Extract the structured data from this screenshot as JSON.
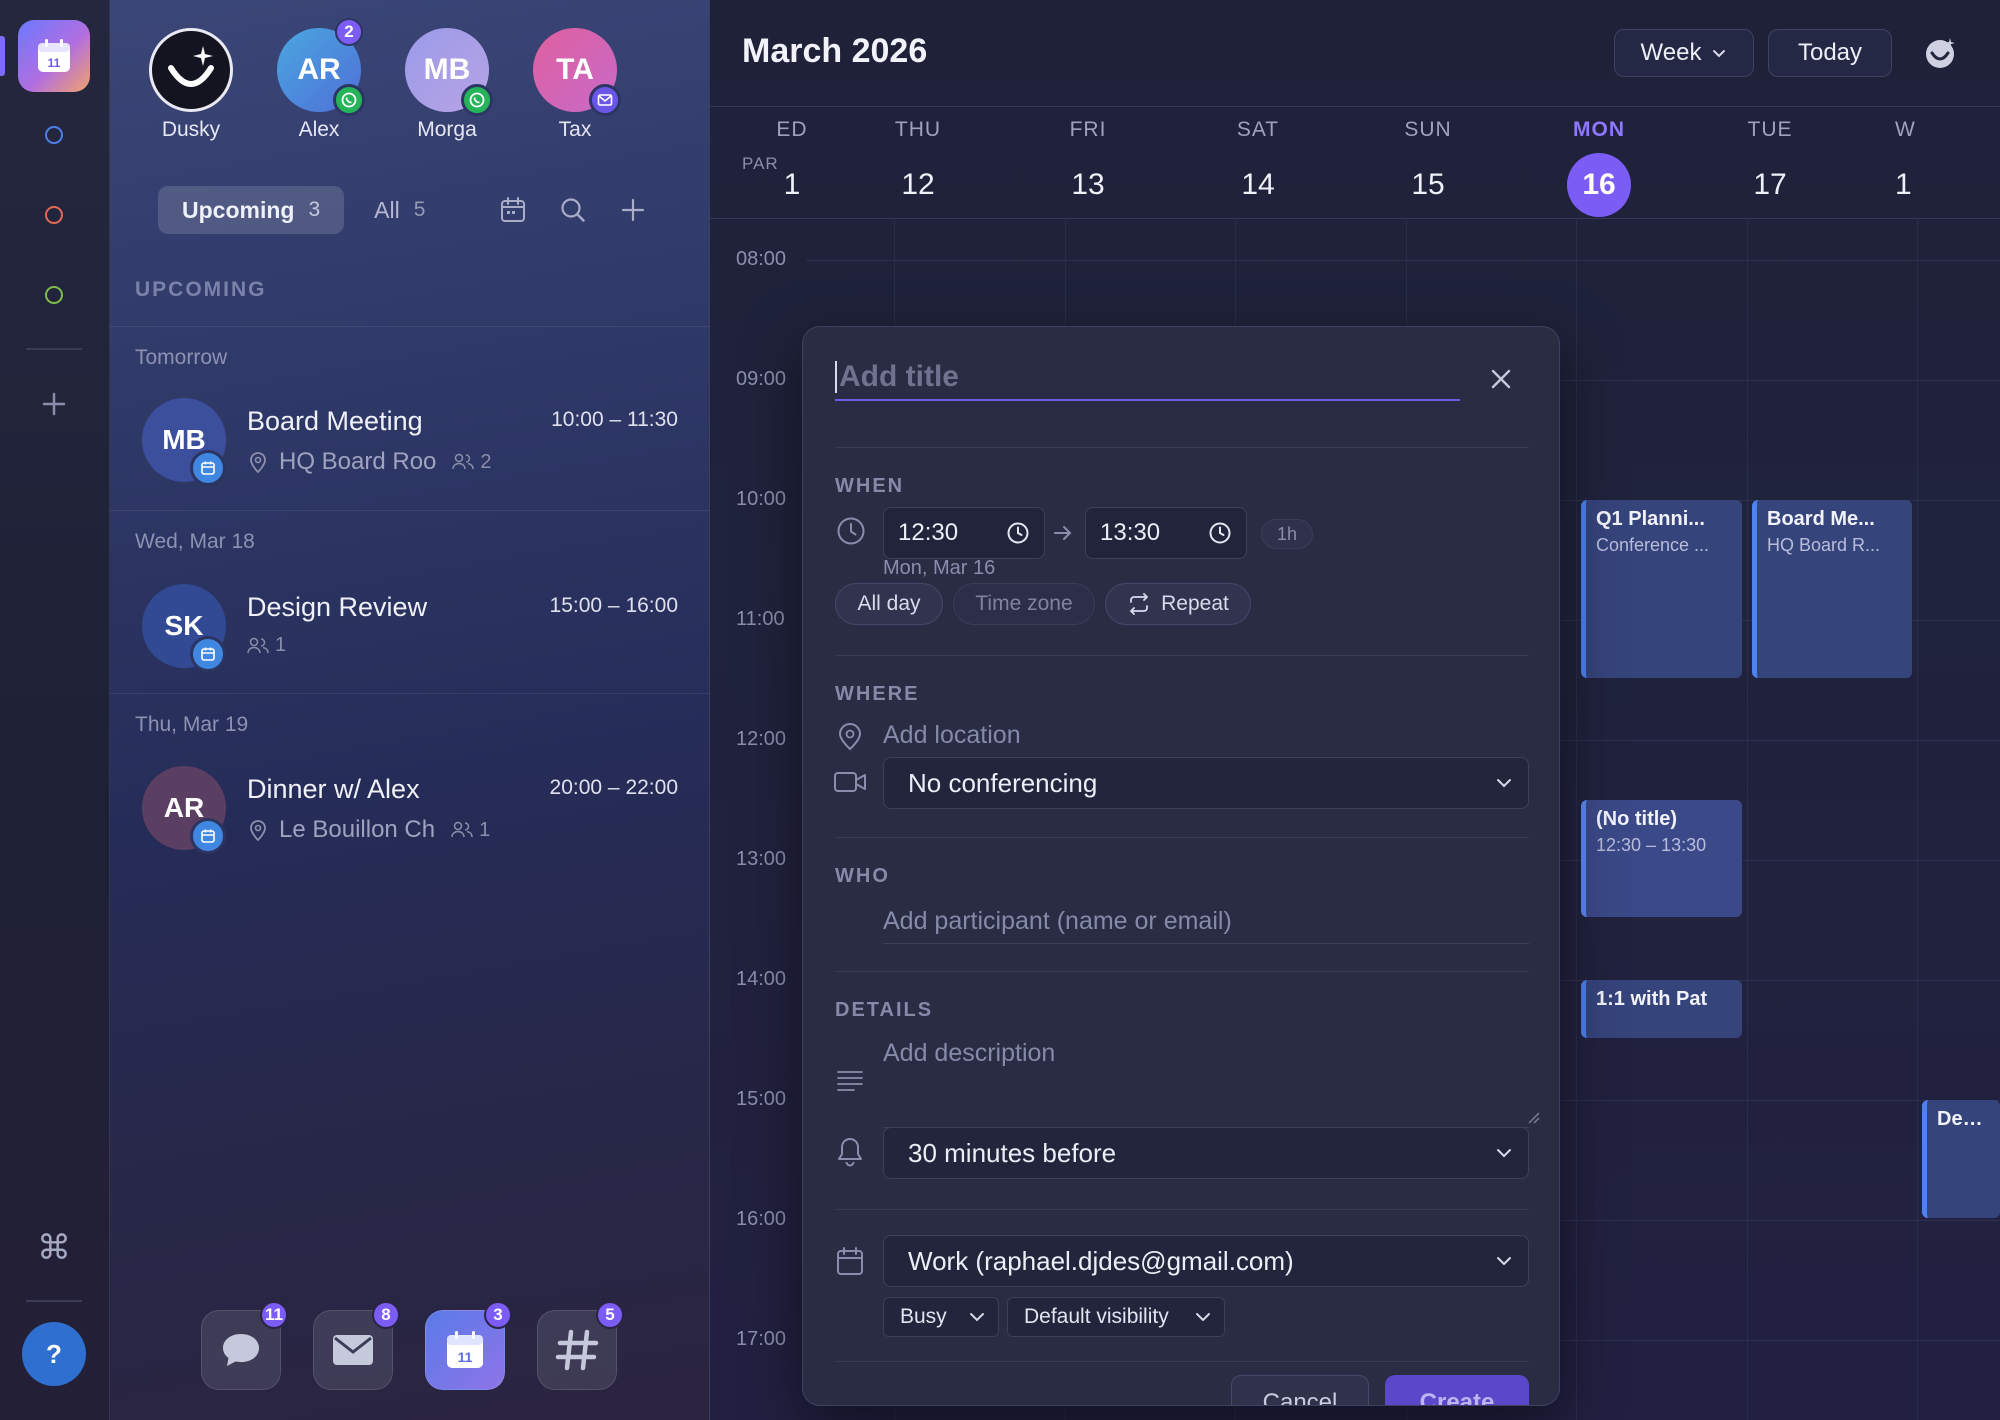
{
  "rail": {
    "app_icon_day": "11",
    "help_label": "?",
    "command_glyph": "⌘",
    "dot_colors": [
      "#4f7fe8",
      "#e06a55",
      "#7dbb4a"
    ]
  },
  "contacts": [
    {
      "initials": "",
      "name": "Dusky",
      "icon": "dusky-logo-icon"
    },
    {
      "initials": "AR",
      "name": "Alex",
      "badge": "2",
      "channel": "whatsapp-icon"
    },
    {
      "initials": "MB",
      "name": "Morga",
      "channel": "whatsapp-icon"
    },
    {
      "initials": "TA",
      "name": "Tax",
      "channel": "mail-icon"
    }
  ],
  "tabs": {
    "upcoming_label": "Upcoming",
    "upcoming_count": "3",
    "all_label": "All",
    "all_count": "5"
  },
  "list": {
    "section_label": "UPCOMING",
    "groups": [
      {
        "day": "Tomorrow",
        "event": {
          "initials": "MB",
          "title": "Board Meeting",
          "time": "10:00 – 11:30",
          "location": "HQ Board Roo",
          "people": "2"
        }
      },
      {
        "day": "Wed, Mar 18",
        "event": {
          "initials": "SK",
          "title": "Design Review",
          "time": "15:00 – 16:00",
          "location": "",
          "people": "1"
        }
      },
      {
        "day": "Thu, Mar 19",
        "event": {
          "initials": "AR",
          "title": "Dinner w/ Alex",
          "time": "20:00 – 22:00",
          "location": "Le Bouillon Ch",
          "people": "1"
        }
      }
    ]
  },
  "dock": [
    {
      "icon": "chat-icon",
      "count": "11"
    },
    {
      "icon": "mail-icon",
      "count": "8"
    },
    {
      "icon": "calendar-icon",
      "count": "3",
      "day": "11"
    },
    {
      "icon": "hashtag-icon",
      "count": "5"
    }
  ],
  "calendar": {
    "title": "March 2026",
    "view_label": "Week",
    "today_label": "Today",
    "timezone_label": "PAR",
    "days": [
      {
        "name": "ED",
        "date": "1"
      },
      {
        "name": "THU",
        "date": "12"
      },
      {
        "name": "FRI",
        "date": "13"
      },
      {
        "name": "SAT",
        "date": "14"
      },
      {
        "name": "SUN",
        "date": "15"
      },
      {
        "name": "MON",
        "date": "16",
        "today": true
      },
      {
        "name": "TUE",
        "date": "17"
      },
      {
        "name": "W",
        "date": "1"
      }
    ],
    "hours": [
      "08:00",
      "09:00",
      "10:00",
      "11:00",
      "12:00",
      "13:00",
      "14:00",
      "15:00",
      "16:00",
      "17:00"
    ],
    "events": [
      {
        "title": "Q1 Planni...",
        "subtitle": "Conference ..."
      },
      {
        "title": "Board Me...",
        "subtitle": "HQ Board R..."
      },
      {
        "title": "(No title)",
        "subtitle": "12:30 – 13:30"
      },
      {
        "title": "1:1 with Pat",
        "subtitle": ""
      },
      {
        "title": "Desig",
        "subtitle": ""
      }
    ]
  },
  "modal": {
    "title_placeholder": "Add title",
    "when_label": "WHEN",
    "start_time": "12:30",
    "end_time": "13:30",
    "duration": "1h",
    "date": "Mon, Mar 16",
    "all_day_label": "All day",
    "time_zone_label": "Time zone",
    "repeat_label": "Repeat",
    "where_label": "WHERE",
    "location_placeholder": "Add location",
    "conferencing": "No conferencing",
    "who_label": "WHO",
    "participant_placeholder": "Add participant (name or email)",
    "details_label": "DETAILS",
    "description_placeholder": "Add description",
    "reminder": "30 minutes before",
    "calendar_account": "Work (raphael.djdes@gmail.com)",
    "busy_label": "Busy",
    "visibility_label": "Default visibility",
    "cancel_label": "Cancel",
    "create_label": "Create"
  }
}
